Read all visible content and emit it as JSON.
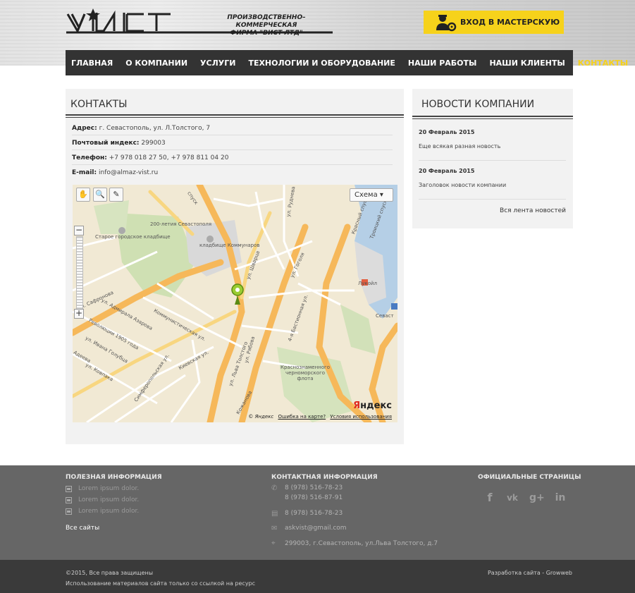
{
  "header": {
    "logo_text": "ВИСТ",
    "company_line1": "ПРОИЗВОДСТВЕННО–КОММЕРЧЕСКАЯ",
    "company_line2": "ФИРМА \"ВИСТ ЛТД\"",
    "login_label": "ВХОД В МАСТЕРСКУЮ",
    "login_icon": "worker-gear-icon",
    "accent": "#f6d21b"
  },
  "nav": {
    "items": [
      {
        "label": "ГЛАВНАЯ"
      },
      {
        "label": "О КОМПАНИИ"
      },
      {
        "label": "УСЛУГИ"
      },
      {
        "label": "ТЕХНОЛОГИИ И ОБОРУДОВАНИЕ"
      },
      {
        "label": "НАШИ РАБОТЫ"
      },
      {
        "label": "НАШИ КЛИЕНТЫ"
      },
      {
        "label": "КОНТАКТЫ",
        "active": true
      }
    ]
  },
  "contacts": {
    "title": "КОНТАКТЫ",
    "address_label": "Адрес:",
    "address": "г. Севастополь, ул. Л.Толстого, 7",
    "zip_label": "Почтовый индекс:",
    "zip": "299003",
    "phone_label": "Телефон:",
    "phone": "+7 978 018 27 50, +7 978 811 04 20",
    "email_label": "E-mail:",
    "email": "info@almaz-vist.ru"
  },
  "map": {
    "type_select": "Схема ▾",
    "copyright": "© Яндекс",
    "error_link": "Ошибка на карте?",
    "terms_link": "Условия использования",
    "logo_y": "Я",
    "logo_rest": "ндекс",
    "labels": {
      "cemetery_old": "Старое городское кладбище",
      "cemetery_communards": "кладбище Коммунаров",
      "anniversary": "200-летия Севастополя",
      "tolstogo": "ул. Льва Толстого",
      "shvarts": "ул. Шварца",
      "gogolya": "ул. Гоголя",
      "bastion": "4-я Бастионная ул.",
      "ryibova": "ул. Рябова",
      "kommun": "Коммунистическая ул.",
      "kievskaya": "Киевская ул.",
      "safronova": "ул. Сафронова",
      "azarova": "ул. Адмирала Азарова",
      "revolution": "Революции 1905 года",
      "golubtsa": "ул. Ивана Голубца",
      "adeeva": "Адеева",
      "kovpaka": "ул. Ковпака",
      "simferopol": "Симферопольская ул.",
      "sebastopol": "Севаст",
      "lukoil": "Лукойл",
      "fleet": "Краснознаменного черноморского флота",
      "krasny_spusk": "Красный спуск",
      "troitsky": "Троицкий спуск",
      "kozhanova": "Кожанова",
      "spusk": "спуск",
      "rudneva": "ул. Руднева"
    }
  },
  "news": {
    "title": "НОВОСТИ КОМПАНИИ",
    "items": [
      {
        "date": "20 Февраль 2015",
        "text": "Еще всякая разная новость"
      },
      {
        "date": "20 Февраль 2015",
        "text": "Заголовок новости компании"
      }
    ],
    "all_link": "Вся лента новостей"
  },
  "footer": {
    "useful_title": "ПОЛЕЗНАЯ ИНФОРМАЦИЯ",
    "useful_links": [
      "Lorem ipsum dolor.",
      "Lorem ipsum dolor.",
      "Lorem ipsum dolor."
    ],
    "all_sites": "Все сайты",
    "contact_title": "КОНТАКТНАЯ ИНФОРМАЦИЯ",
    "phone1": "8 (978) 516-78-23",
    "phone2": "8 (978) 516-87-91",
    "fax": "8 (978) 516-78-23",
    "email": "askvist@gmail.com",
    "address": "299003, г.Севастополь, ул.Льва Толстого, д.7",
    "official_title": "ОФИЦИАЛЬНЫЕ СТРАНИЦЫ",
    "social": {
      "facebook": "f",
      "vk": "vk",
      "gplus": "g+",
      "linkedin": "in"
    }
  },
  "bottom": {
    "copyright": "©2015, Все права защищены",
    "usage": "Использование материалов сайта только со ссылкой на ресурс",
    "developer": "Разработка сайта - Growweb"
  }
}
